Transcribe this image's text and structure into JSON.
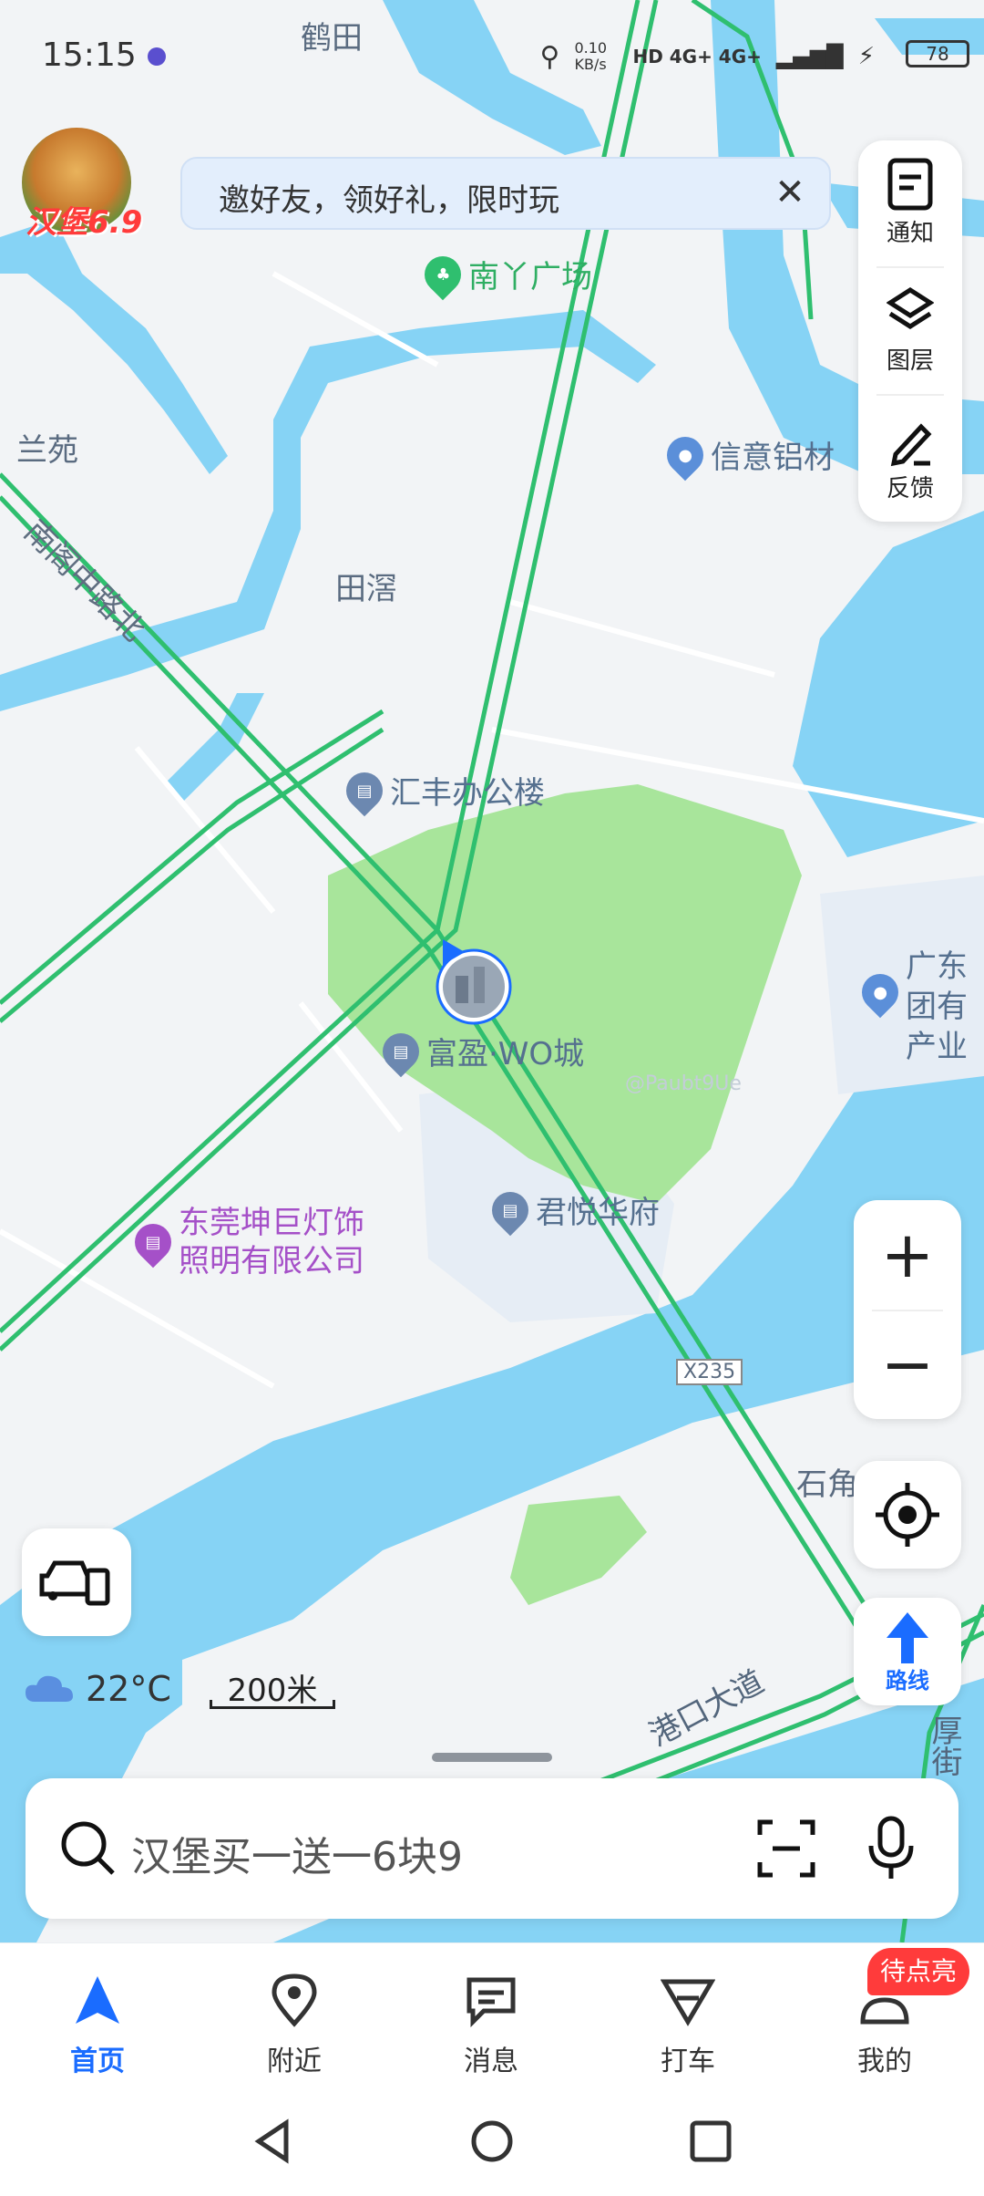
{
  "status_bar": {
    "time": "15:15",
    "speed": "0.10 KB/s",
    "network": "HD 4G+ 4G+",
    "battery": "78"
  },
  "banner": {
    "text": "邀好友，领好礼，限时玩"
  },
  "promo": {
    "label": "汉堡6.9"
  },
  "right_panel": {
    "notify": "通知",
    "layers": "图层",
    "feedback": "反馈"
  },
  "map": {
    "labels": {
      "hetian": "鹤田",
      "lanyuan": "兰苑",
      "tianxi": "田滘",
      "road_nange": "南阁中路北",
      "x235": "X235",
      "shijiao": "石角",
      "gangkou": "港口大道",
      "housie": "厚街"
    },
    "pois": {
      "nanya": "南丫广场",
      "xinyi": "信意铝材",
      "huifeng": "汇丰办公楼",
      "guangdong": "广东\n团有\n产业",
      "fuying": "富盈·WO城",
      "junyue": "君悦华府",
      "dongguan": "东莞坤巨灯饰\n照明有限公司",
      "watermark": "@Paubt9Ue"
    }
  },
  "weather": {
    "temp": "22°C"
  },
  "scale": {
    "label": "200米"
  },
  "search": {
    "placeholder": "汉堡买一送一6块9"
  },
  "tabs": {
    "home": "首页",
    "nearby": "附近",
    "messages": "消息",
    "taxi": "打车",
    "mine": "我的"
  },
  "badge": {
    "mine": "待点亮"
  },
  "colors": {
    "accent": "#1a6cff",
    "water": "#86d3f5",
    "road": "#2fbf6f",
    "park": "#a8e59b"
  }
}
